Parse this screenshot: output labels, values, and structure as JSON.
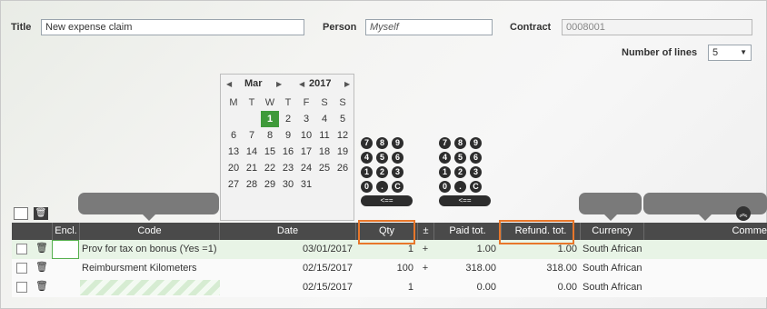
{
  "form": {
    "title_label": "Title",
    "title_value": "New expense claim",
    "person_label": "Person",
    "person_value": "Myself",
    "contract_label": "Contract",
    "contract_value": "0008001",
    "lines_label": "Number of lines",
    "lines_value": "5"
  },
  "calendar": {
    "month": "Mar",
    "year": "2017",
    "weekdays": [
      "M",
      "T",
      "W",
      "T",
      "F",
      "S",
      "S"
    ],
    "weeks": [
      [
        "",
        "",
        "1",
        "2",
        "3",
        "4",
        "5"
      ],
      [
        "6",
        "7",
        "8",
        "9",
        "10",
        "11",
        "12"
      ],
      [
        "13",
        "14",
        "15",
        "16",
        "17",
        "18",
        "19"
      ],
      [
        "20",
        "21",
        "22",
        "23",
        "24",
        "25",
        "26"
      ],
      [
        "27",
        "28",
        "29",
        "30",
        "31",
        "",
        ""
      ]
    ],
    "selected_day": "1"
  },
  "keypad": {
    "rows": [
      [
        "7",
        "8",
        "9"
      ],
      [
        "4",
        "5",
        "6"
      ],
      [
        "1",
        "2",
        "3"
      ],
      [
        "0",
        ".",
        "C"
      ]
    ],
    "back_label": "<=="
  },
  "table": {
    "columns": [
      "Encl.",
      "Code",
      "Date",
      "Qty",
      "±",
      "Paid tot.",
      "Refund. tot.",
      "Currency",
      "Comme"
    ],
    "rows": [
      {
        "code": "Prov for tax on bonus (Yes =1)",
        "date": "03/01/2017",
        "qty": "1",
        "pm": "+",
        "paid": "1.00",
        "refund": "1.00",
        "currency": "South African"
      },
      {
        "code": "Reimbursment Kilometers",
        "date": "02/15/2017",
        "qty": "100",
        "pm": "+",
        "paid": "318.00",
        "refund": "318.00",
        "currency": "South African"
      },
      {
        "code": "",
        "date": "02/15/2017",
        "qty": "1",
        "pm": "",
        "paid": "0.00",
        "refund": "0.00",
        "currency": "South African"
      }
    ]
  },
  "icons": {
    "trash": "trash-icon",
    "collapse": "double-chevron-up-icon",
    "prev": "triangle-left-icon",
    "next": "triangle-right-icon",
    "dropdown": "chevron-down-icon"
  },
  "colors": {
    "header_bg": "#4a4a4a",
    "selected_row": "#e8f4e6",
    "today": "#3f9a3a",
    "highlight": "#e8772b"
  }
}
